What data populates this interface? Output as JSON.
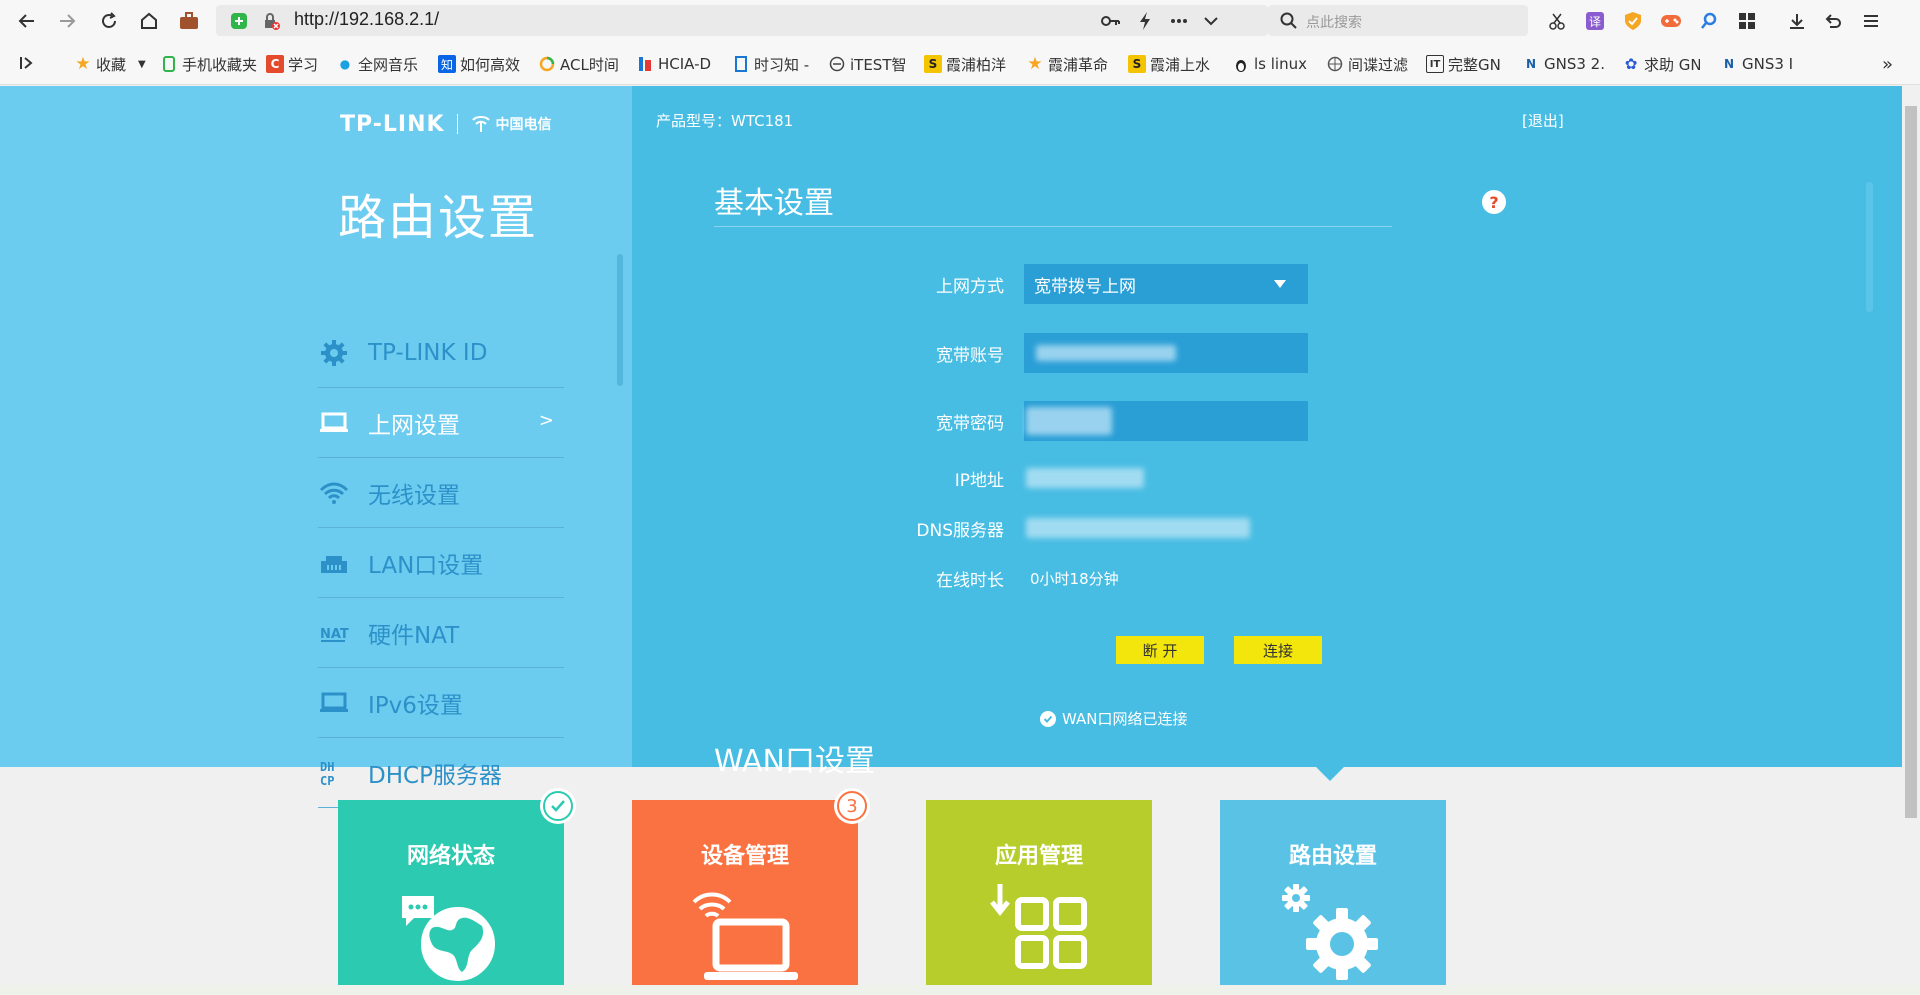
{
  "browser": {
    "url": "http://192.168.2.1/",
    "search_placeholder": "点此搜索",
    "bookmarks": [
      {
        "label": "收藏",
        "icon": "star-icon"
      },
      {
        "label": "手机收藏夹",
        "icon": "phone-icon"
      },
      {
        "label": "学习",
        "icon": "c-icon"
      },
      {
        "label": "全网音乐",
        "icon": "music-icon"
      },
      {
        "label": "如何高效",
        "icon": "zhihu-icon"
      },
      {
        "label": "ACL时间",
        "icon": "acl-icon"
      },
      {
        "label": "HCIA-D",
        "icon": "hcia-icon"
      },
      {
        "label": "时习知 -",
        "icon": "book-icon"
      },
      {
        "label": "iTEST智",
        "icon": "itest-icon"
      },
      {
        "label": "霞浦柏洋",
        "icon": "s-icon"
      },
      {
        "label": "霞浦革命",
        "icon": "star-icon"
      },
      {
        "label": "霞浦上水",
        "icon": "s-icon"
      },
      {
        "label": "ls linux",
        "icon": "linux-icon"
      },
      {
        "label": "间谍过滤",
        "icon": "globe-icon"
      },
      {
        "label": "完整GN",
        "icon": "it-icon"
      },
      {
        "label": "GNS3 2.",
        "icon": "gns3-icon"
      },
      {
        "label": "求助 GN",
        "icon": "paw-icon"
      },
      {
        "label": "GNS3 I",
        "icon": "gns3-icon"
      }
    ]
  },
  "header": {
    "brand": "TP-LINK",
    "partner": "中国电信",
    "model": "产品型号：WTC181",
    "logout": "[退出]"
  },
  "sidebar": {
    "title": "路由设置",
    "items": [
      {
        "label": "TP-LINK ID",
        "icon": "gear-icon",
        "active": false
      },
      {
        "label": "上网设置",
        "icon": "laptop-icon",
        "active": true,
        "arrow": ">"
      },
      {
        "label": "无线设置",
        "icon": "wifi-icon",
        "active": false
      },
      {
        "label": "LAN口设置",
        "icon": "lan-port-icon",
        "active": false
      },
      {
        "label": "硬件NAT",
        "icon": "nat-icon",
        "active": false
      },
      {
        "label": "IPv6设置",
        "icon": "laptop-icon",
        "active": false
      },
      {
        "label": "DHCP服务器",
        "icon": "dhcp-icon",
        "active": false
      }
    ]
  },
  "main": {
    "section_title": "基本设置",
    "help": "?",
    "fields": {
      "mode_label": "上网方式",
      "mode_value": "宽带拨号上网",
      "account_label": "宽带账号",
      "password_label": "宽带密码",
      "ip_label": "IP地址",
      "dns_label": "DNS服务器",
      "uptime_label": "在线时长",
      "uptime_value": "0小时18分钟"
    },
    "buttons": {
      "disconnect": "断 开",
      "connect": "连接"
    },
    "status": "WAN口网络已连接",
    "wan_title": "WAN口设置"
  },
  "tiles": [
    {
      "label": "网络状态",
      "color": "#2ccbb1",
      "icon": "globe-chat-icon",
      "badge": "check"
    },
    {
      "label": "设备管理",
      "color": "#fb7242",
      "icon": "laptop-wifi-icon",
      "badge": "3"
    },
    {
      "label": "应用管理",
      "color": "#b6cd2c",
      "icon": "apps-grid-icon",
      "badge": ""
    },
    {
      "label": "路由设置",
      "color": "#5ac3e5",
      "icon": "gears-icon",
      "badge": ""
    }
  ],
  "colors": {
    "sidebar_bg": "#6cccf0",
    "content_bg": "#48bde3",
    "button_yellow": "#f2e60c",
    "input_bg": "#2a9fd6"
  }
}
